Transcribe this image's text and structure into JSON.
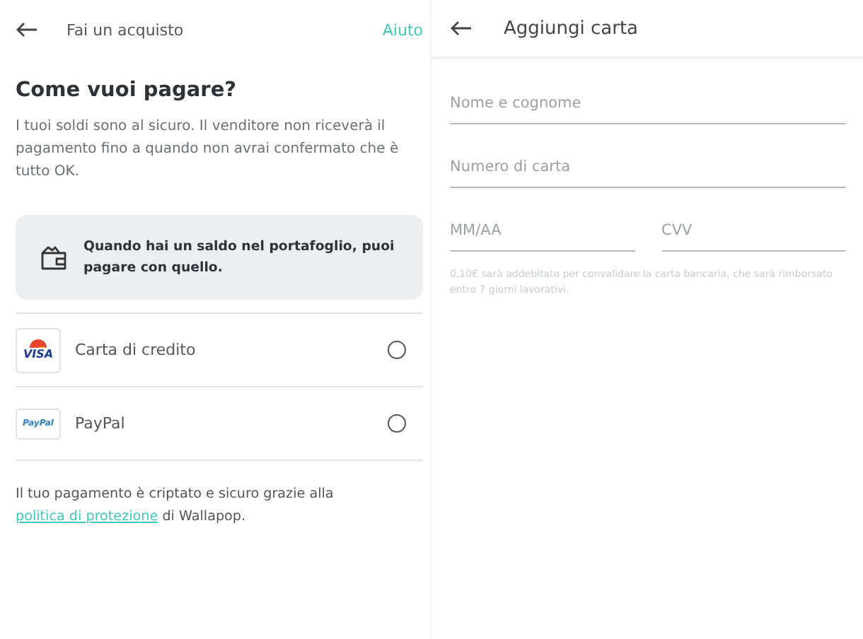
{
  "purchase": {
    "header": {
      "title": "Fai un acquisto",
      "help": "Aiuto"
    },
    "heading": "Come vuoi pagare?",
    "intro": "I tuoi soldi sono al sicuro. Il venditore non riceverà il pagamento fino a quando non avrai confermato che è tutto OK.",
    "wallet_notice": "Quando hai un saldo nel portafoglio, puoi pagare con quello.",
    "methods": [
      {
        "kind": "card",
        "logo_text": "VISA",
        "label": "Carta di credito",
        "selected": false
      },
      {
        "kind": "paypal",
        "logo_text": "PayPal",
        "label": "PayPal",
        "selected": false
      }
    ],
    "footer": {
      "before": "Il tuo pagamento è criptato e sicuro grazie alla",
      "link": "politica di protezione",
      "after": "di Wallapop."
    }
  },
  "add_card": {
    "header": {
      "title": "Aggiungi carta"
    },
    "fields": [
      {
        "placeholder": "Nome e cognome"
      },
      {
        "placeholder": "Numero di carta"
      }
    ],
    "half_fields": [
      {
        "placeholder": "MM/AA"
      },
      {
        "placeholder": "CVV"
      }
    ],
    "note": "0,10€ sarà addebitato per convalidare la carta bancaria, che sarà rimborsato entro 7 giorni lavorativi."
  }
}
